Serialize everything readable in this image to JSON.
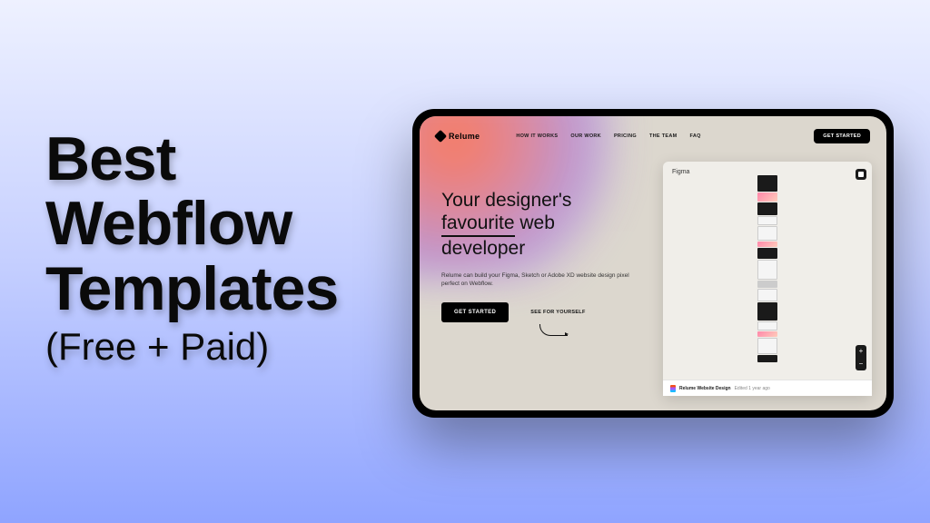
{
  "headline": {
    "line1": "Best",
    "line2": "Webflow",
    "line3": "Templates",
    "subtitle": "(Free + Paid)"
  },
  "site": {
    "brand": "Relume",
    "nav": {
      "how_it_works": "HOW IT WORKS",
      "our_work": "OUR WORK",
      "pricing": "PRICING",
      "the_team": "THE TEAM",
      "faq": "FAQ"
    },
    "cta_header": "GET STARTED"
  },
  "hero": {
    "title_l1": "Your designer's",
    "title_l2a": "favourite",
    "title_l2b": " web",
    "title_l3": "developer",
    "body": "Relume can build your Figma, Sketch or Adobe XD website design pixel perfect on Webflow.",
    "cta": "GET STARTED",
    "see_link": "SEE FOR YOURSELF"
  },
  "figma": {
    "label": "Figma",
    "file_name": "Relume Website Design",
    "file_meta": "Edited 1 year ago",
    "zoom_plus": "+",
    "zoom_minus": "−"
  }
}
